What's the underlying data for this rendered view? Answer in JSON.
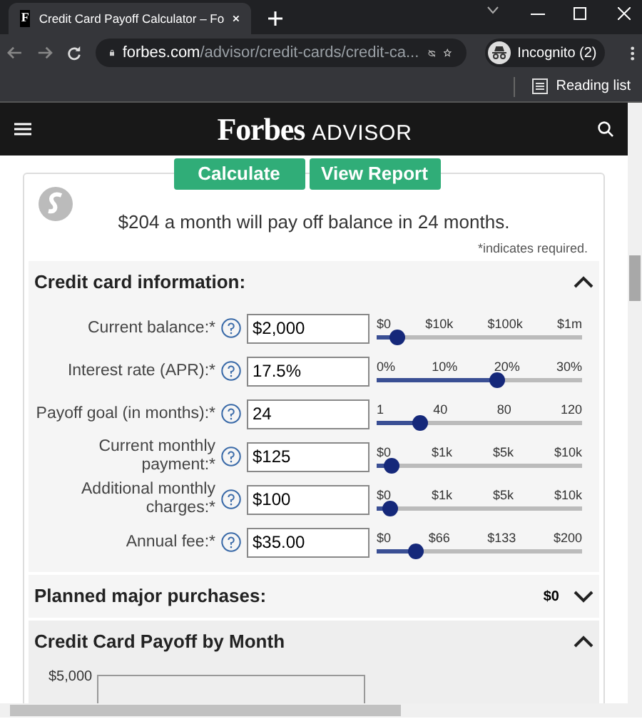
{
  "browser": {
    "favicon": "F",
    "tab_title": "Credit Card Payoff Calculator – Fo",
    "url_host": "forbes.com",
    "url_path": "/advisor/credit-cards/credit-ca...",
    "profile": "Incognito (2)",
    "reading_list": "Reading list"
  },
  "header": {
    "logo": "Forbes",
    "logo_suffix": "ADVISOR"
  },
  "buttons": [
    "Calculate",
    "View Report"
  ],
  "result": "$204 a month will pay off balance in 24 months.",
  "required_note": "*indicates required.",
  "credit_section": {
    "title": "Credit card information:",
    "expanded": true,
    "fields": [
      {
        "label": "Current balance:*",
        "value": "$2,000",
        "ticks": [
          "$0",
          "$10k",
          "$100k",
          "$1m"
        ],
        "level": 0.1
      },
      {
        "label": "Interest rate (APR):*",
        "value": "17.5%",
        "ticks": [
          "0%",
          "10%",
          "20%",
          "30%"
        ],
        "level": 0.58
      },
      {
        "label": "Payoff goal (in months):*",
        "value": "24",
        "ticks": [
          "1",
          "40",
          "80",
          "120"
        ],
        "level": 0.21
      },
      {
        "label": "Current monthly payment:*",
        "value": "$125",
        "ticks": [
          "$0",
          "$1k",
          "$5k",
          "$10k"
        ],
        "level": 0.07
      },
      {
        "label": "Additional monthly charges:*",
        "value": "$100",
        "ticks": [
          "$0",
          "$1k",
          "$5k",
          "$10k"
        ],
        "level": 0.06
      },
      {
        "label": "Annual fee:*",
        "value": "$35.00",
        "ticks": [
          "$0",
          "$66",
          "$133",
          "$200"
        ],
        "level": 0.19
      }
    ]
  },
  "purchases_section": {
    "title": "Planned major purchases:",
    "amount": "$0",
    "expanded": false
  },
  "payoff_section": {
    "title": "Credit Card Payoff by Month",
    "expanded": true,
    "axis_label": "$5,000"
  }
}
